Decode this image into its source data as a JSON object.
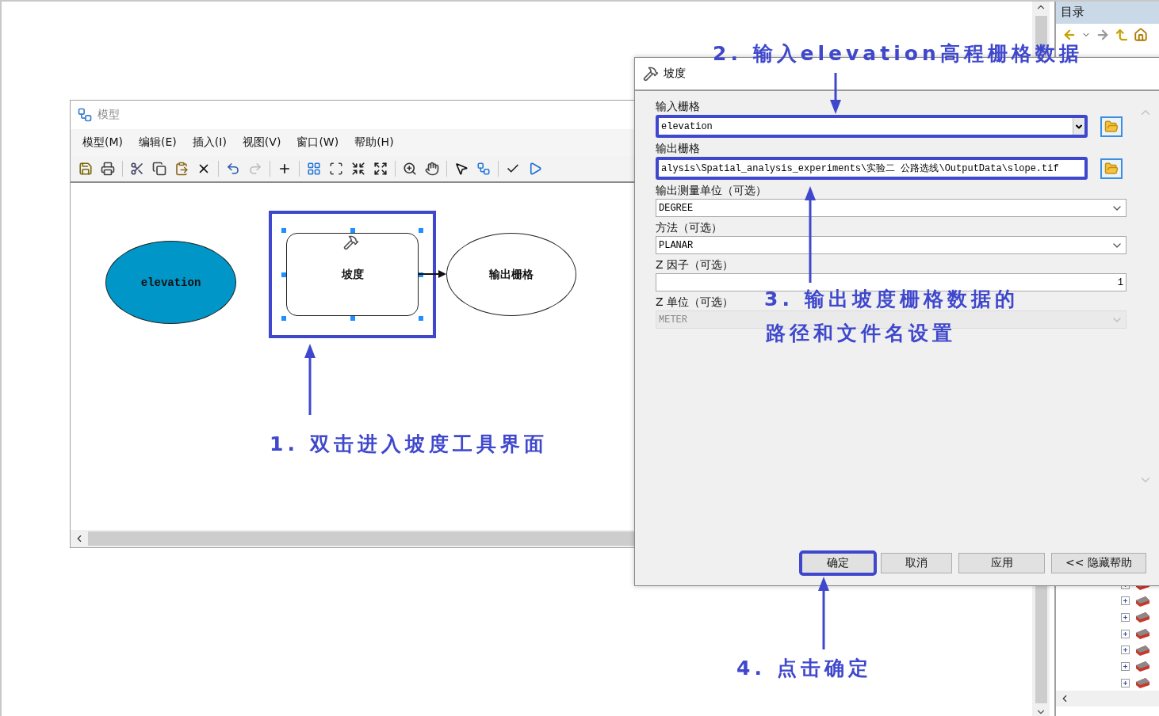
{
  "model_window": {
    "title": "模型",
    "menu": [
      "模型(M)",
      "编辑(E)",
      "插入(I)",
      "视图(V)",
      "窗口(W)",
      "帮助(H)"
    ],
    "nodes": [
      {
        "kind": "input",
        "label": "elevation",
        "selected": false,
        "highlighted": false
      },
      {
        "kind": "tool",
        "label": "坡度",
        "selected": true,
        "highlighted": true
      },
      {
        "kind": "output",
        "label": "输出栅格",
        "selected": false,
        "highlighted": false
      }
    ]
  },
  "dialog": {
    "title": "坡度",
    "fields": [
      {
        "kind": "combo",
        "label": "输入栅格",
        "value": "elevation",
        "disabled": false,
        "highlighted": true
      },
      {
        "kind": "path",
        "label": "输出栅格",
        "value": "alysis\\Spatial_analysis_experiments\\实验二 公路选线\\OutputData\\slope.tif",
        "disabled": false,
        "highlighted": true
      },
      {
        "kind": "dropdown",
        "label": "输出测量单位（可选）",
        "value": "DEGREE",
        "disabled": false,
        "highlighted": false
      },
      {
        "kind": "dropdown",
        "label": "方法（可选）",
        "value": "PLANAR",
        "disabled": false,
        "highlighted": false
      },
      {
        "kind": "number",
        "label": "Z 因子（可选）",
        "value": "1",
        "disabled": false,
        "highlighted": false
      },
      {
        "kind": "dropdown",
        "label": "Z 单位（可选）",
        "value": "METER",
        "disabled": true,
        "highlighted": false
      }
    ],
    "buttons": [
      {
        "label": "确定",
        "highlighted": true
      },
      {
        "label": "取消",
        "highlighted": false
      },
      {
        "label": "应用",
        "highlighted": false
      },
      {
        "label": "<< 隐藏帮助",
        "highlighted": false
      }
    ]
  },
  "catalog": {
    "title": "目录"
  },
  "annotations": [
    {
      "text": "1. 双击进入坡度工具界面"
    },
    {
      "text": "2. 输入elevation高程栅格数据"
    },
    {
      "text": "3. 输出坡度栅格数据的"
    },
    {
      "text": "路径和文件名设置"
    },
    {
      "text": "4. 点击确定"
    }
  ]
}
